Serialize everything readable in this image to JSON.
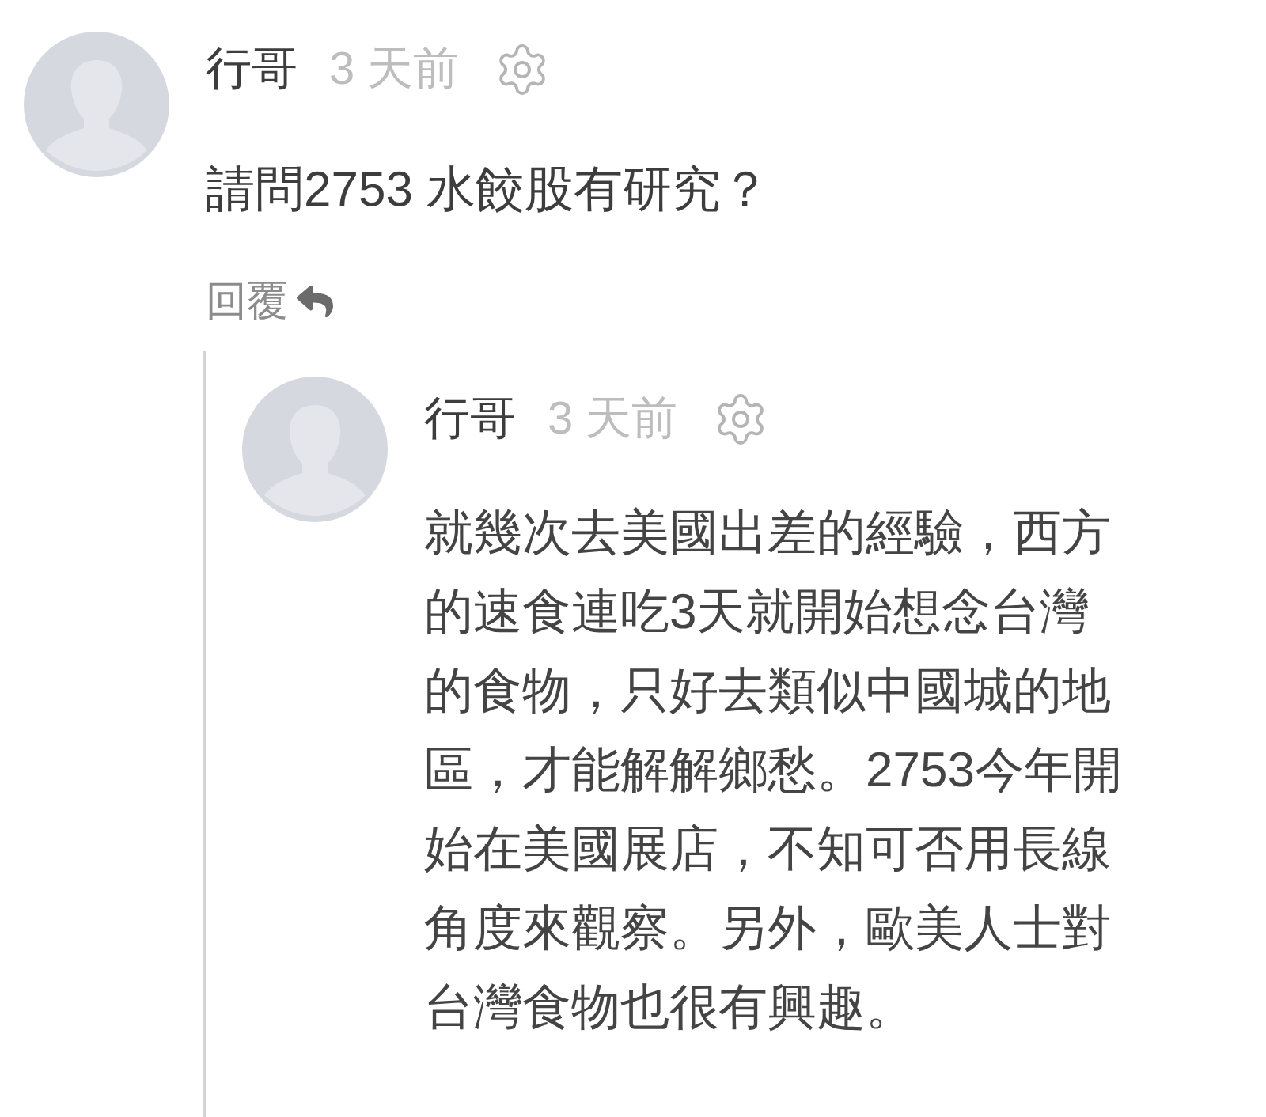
{
  "comments": [
    {
      "author": "行哥",
      "time": "3 天前",
      "text": "請問2753 水餃股有研究？",
      "reply_label": "回覆",
      "replies": [
        {
          "author": "行哥",
          "time": "3 天前",
          "text_lines": [
            "就幾次去美國出差的經驗，西方",
            "的速食連吃3天就開始想念台灣",
            "的食物，只好去類似中國城的地",
            "區，才能解解鄉愁。2753今年開",
            "始在美國展店，不知可否用長線",
            "角度來觀察。另外，歐美人士對",
            "台灣食物也很有興趣。"
          ]
        }
      ]
    }
  ]
}
